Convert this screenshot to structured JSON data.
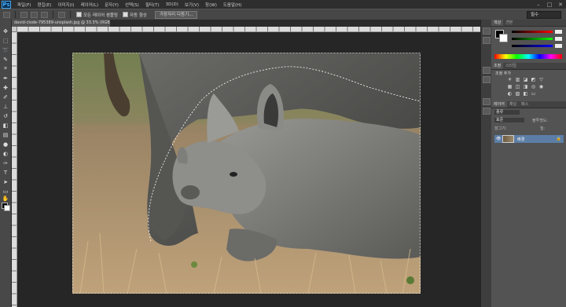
{
  "app": {
    "logo": "Ps"
  },
  "menu": [
    "파일(F)",
    "편집(E)",
    "이미지(I)",
    "레이어(L)",
    "문자(Y)",
    "선택(S)",
    "필터(T)",
    "3D(D)",
    "보기(V)",
    "창(W)",
    "도움말(H)"
  ],
  "window_controls": [
    "–",
    "□",
    "✕"
  ],
  "options_bar": {
    "antialias_label": "모든 레이어 샘플링",
    "auto_enhance_label": "자동 향상",
    "refine_edge_button": "가장자리 다듬기...",
    "workspace": "필수"
  },
  "document": {
    "tab_title": "david-clode-795389-unsplash.jpg @ 33.3% (RGB/8) *"
  },
  "panels": {
    "color_tabs": [
      "색상",
      "견본"
    ],
    "adjust_tabs": [
      "조정",
      "스타일"
    ],
    "adjust_title": "조정 추가",
    "layers_tabs": [
      "레이어",
      "채널",
      "패스"
    ],
    "layers_kind_label": "종류",
    "blend_mode": "표준",
    "opacity_label": "불투명도:",
    "fill_label": "칠:",
    "lock_label": "잠그기:",
    "layer_name": "배경"
  },
  "colors": {
    "foreground": "#000000",
    "background": "#ffffff",
    "selection_layer": "#5c7ea6"
  },
  "icons": [
    "marquee-icon",
    "lasso-icon",
    "quick-select-icon",
    "crop-icon",
    "eyedropper-icon",
    "healing-icon",
    "brush-icon",
    "stamp-icon",
    "history-brush-icon",
    "eraser-icon",
    "gradient-icon",
    "blur-icon",
    "dodge-icon",
    "pen-icon",
    "type-icon",
    "path-select-icon",
    "shape-icon",
    "hand-icon",
    "zoom-icon"
  ]
}
